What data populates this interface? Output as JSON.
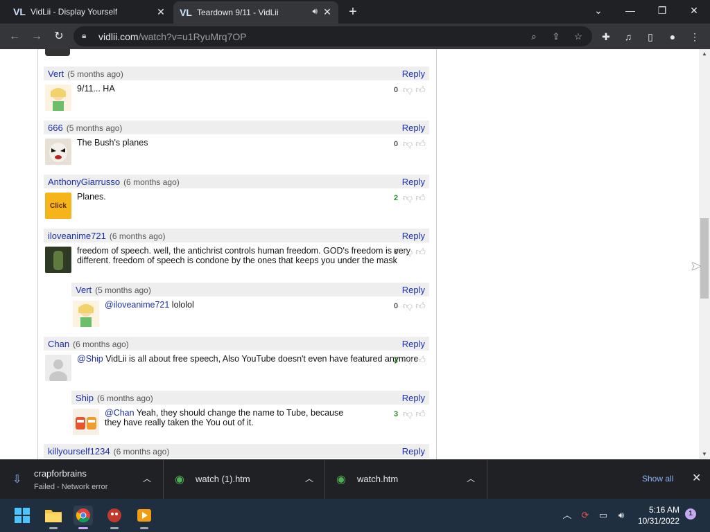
{
  "browser": {
    "tabs": [
      {
        "title": "VidLii - Display Yourself",
        "favicon": "VL"
      },
      {
        "title": "Teardown 9/11 - VidLii",
        "favicon": "VL"
      }
    ],
    "url_host": "vidlii.com",
    "url_path": "/watch?v=u1RyuMrq7OP"
  },
  "comments": [
    {
      "user": "Vert",
      "time": "(5 months ago)",
      "reply": "Reply",
      "text": "9/11... HA",
      "votes": "0",
      "avatar_label": ""
    },
    {
      "user": "666",
      "time": "(5 months ago)",
      "reply": "Reply",
      "text": "The Bush's planes",
      "votes": "0",
      "avatar_label": ""
    },
    {
      "user": "AnthonyGiarrusso",
      "time": "(6 months ago)",
      "reply": "Reply",
      "text": "Planes.",
      "votes": "2",
      "avatar_label": "Click"
    },
    {
      "user": "iloveanime721",
      "time": "(6 months ago)",
      "reply": "Reply",
      "text_line1": "freedom of speech. well, the antichrist controls human freedom. GOD's freedom is very",
      "text_line2": "different. freedom of speech is condone by the ones that keeps you under the mask",
      "votes": "0"
    },
    {
      "user": "Vert",
      "time": "(5 months ago)",
      "reply": "Reply",
      "mention": "@iloveanime721",
      "text": " lololol",
      "votes": "0"
    },
    {
      "user": "Chan",
      "time": "(6 months ago)",
      "reply": "Reply",
      "mention": "@Ship",
      "text": " VidLii is all about free speech, Also YouTube doesn't even have featured anymore",
      "votes": "2"
    },
    {
      "user": "Ship",
      "time": "(6 months ago)",
      "reply": "Reply",
      "mention": "@Chan",
      "text_line1": " Yeah, they should change the name to Tube, because",
      "text_line2": "they have really taken the You out of it.",
      "votes": "3"
    },
    {
      "user": "killyourself1234",
      "time": "(6 months ago)",
      "reply": "Reply"
    }
  ],
  "downloads": [
    {
      "name": "crapforbrains",
      "status": "Failed - Network error"
    },
    {
      "name": "watch (1).htm"
    },
    {
      "name": "watch.htm"
    }
  ],
  "downloads_show_all": "Show all",
  "taskbar": {
    "time": "5:16 AM",
    "date": "10/31/2022",
    "notifications": "1"
  },
  "colors": {
    "link": "#1a2ea8",
    "positive_votes": "#2a8a2a",
    "tab_bg": "#202124",
    "toolbar_bg": "#35363a"
  }
}
